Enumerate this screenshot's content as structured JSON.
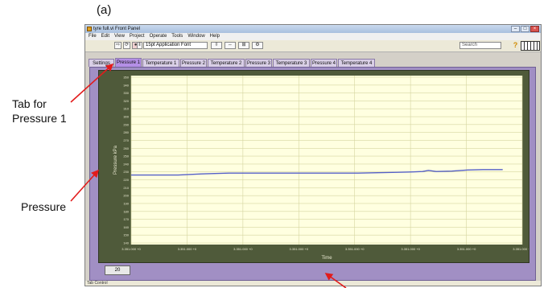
{
  "figure_label": "(a)",
  "annotations": {
    "tab_note_line1": "Tab for",
    "tab_note_line2": "Pressure 1",
    "pressure_note": "Pressure"
  },
  "window": {
    "title": "tyre full.vi Front Panel",
    "menu": [
      "File",
      "Edit",
      "View",
      "Project",
      "Operate",
      "Tools",
      "Window",
      "Help"
    ],
    "font_select": "15pt Application Font",
    "search_placeholder": "Search",
    "status": "Tab Control"
  },
  "tabs": [
    {
      "label": "Settings",
      "active": false
    },
    {
      "label": "Pressure 1",
      "active": true
    },
    {
      "label": "Temperature 1",
      "active": false
    },
    {
      "label": "Pressure 2",
      "active": false
    },
    {
      "label": "Temperature 2",
      "active": false
    },
    {
      "label": "Pressure 3",
      "active": false
    },
    {
      "label": "Temperature 3",
      "active": false
    },
    {
      "label": "Pressure 4",
      "active": false
    },
    {
      "label": "Temperature 4",
      "active": false
    }
  ],
  "graph_tool_label": "20",
  "colors": {
    "plot_bg": "#ffffe0",
    "grid": "#d6d6a0",
    "trace": "#5560c8",
    "annotation_arrow": "#e21b1b"
  },
  "chart_data": {
    "type": "line",
    "xlabel": "Time",
    "ylabel": "Pressure kPa",
    "y_ticks": [
      "140",
      "150",
      "160",
      "170",
      "180",
      "190",
      "200",
      "210",
      "220",
      "230",
      "240",
      "250",
      "260",
      "270",
      "280",
      "290",
      "300",
      "310",
      "320",
      "330",
      "340",
      "350"
    ],
    "x_ticks": [
      "3.351.000 +0",
      "3.351.000 +0",
      "3.351.000 +0",
      "3.351.000 +0",
      "3.351.000 +0",
      "3.351.000 +0",
      "3.351.000 +0",
      "3.351.000 +0"
    ],
    "ylim": [
      138,
      352
    ],
    "xlim": [
      0,
      100
    ],
    "grid": true,
    "series": [
      {
        "x": [
          0,
          12,
          18,
          25,
          38,
          50,
          55,
          58,
          63,
          68,
          72,
          74.5,
          76,
          78,
          82,
          86,
          90,
          95
        ],
        "y": [
          226,
          226,
          227.5,
          228.5,
          228.5,
          228.5,
          228.5,
          228.5,
          229,
          229.5,
          230,
          230.5,
          232,
          230.5,
          231,
          232.5,
          233,
          233
        ]
      }
    ]
  }
}
